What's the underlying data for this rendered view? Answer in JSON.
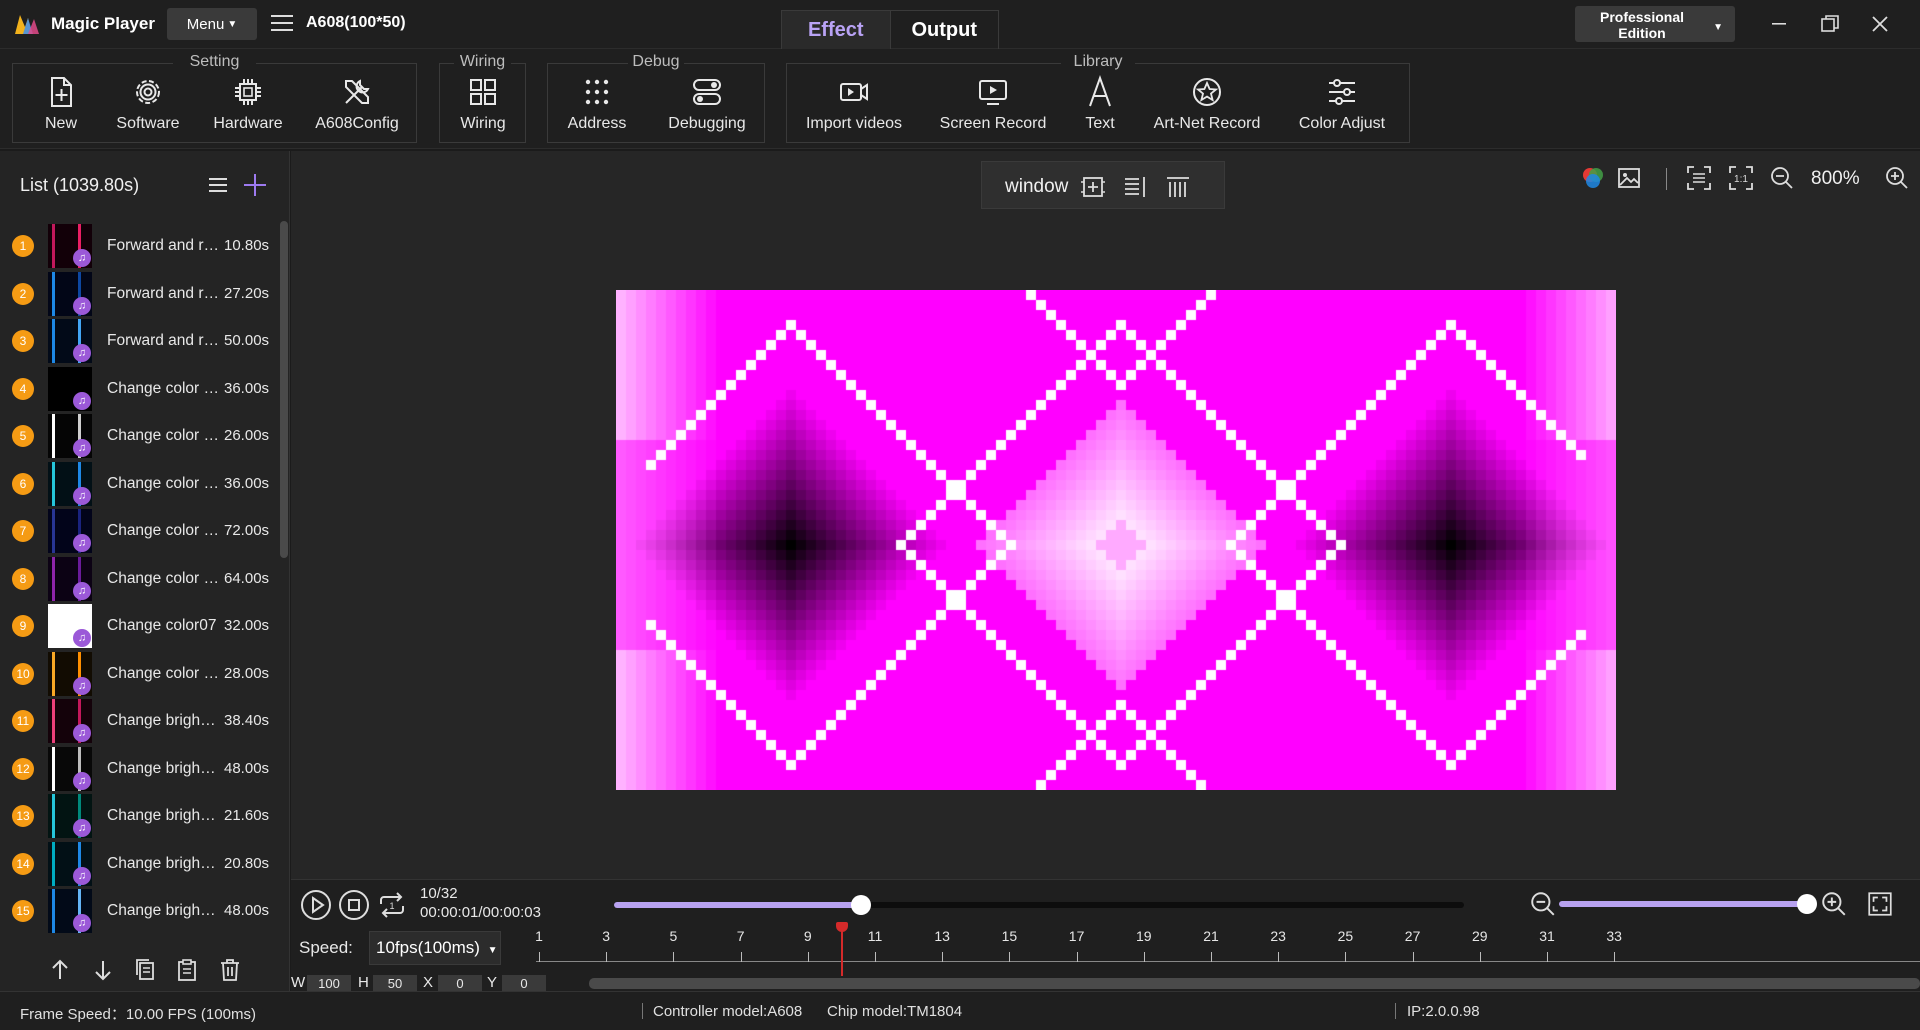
{
  "app": {
    "name": "Magic Player",
    "menu_label": "Menu",
    "device": "A608(100*50)",
    "mode_tabs": [
      "Effect",
      "Output"
    ],
    "active_tab": "Effect",
    "edition_line1": "Professional",
    "edition_line2": "Edition"
  },
  "ribbon": {
    "groups": {
      "setting": "Setting",
      "wiring": "Wiring",
      "debug": "Debug",
      "library": "Library"
    },
    "tools": {
      "new": "New",
      "software": "Software",
      "hardware": "Hardware",
      "a608config": "A608Config",
      "wiring": "Wiring",
      "address": "Address",
      "debugging": "Debugging",
      "import_videos": "Import videos",
      "screen_record": "Screen Record",
      "text": "Text",
      "artnet_record": "Art-Net Record",
      "color_adjust": "Color Adjust"
    }
  },
  "list": {
    "header": "List  (1039.80s)",
    "items": [
      {
        "num": "1",
        "name": "Forward and r…",
        "duration": "10.80s",
        "thumb": "#c2185b",
        "bars": [
          "#c2185b",
          "#e91e63"
        ],
        "bg": "#120008"
      },
      {
        "num": "2",
        "name": "Forward and r…",
        "duration": "27.20s",
        "thumb": "#1565c0",
        "bars": [
          "#1e88e5",
          "#0d47a1"
        ],
        "bg": "#020617"
      },
      {
        "num": "3",
        "name": "Forward and r…",
        "duration": "50.00s",
        "thumb": "#1e88e5",
        "bars": [
          "#1e88e5",
          "#42a5f5"
        ],
        "bg": "#020a18"
      },
      {
        "num": "4",
        "name": "Change color …",
        "duration": "36.00s",
        "thumb": "#000000",
        "bars": [],
        "bg": "#000000"
      },
      {
        "num": "5",
        "name": "Change color …",
        "duration": "26.00s",
        "thumb": "#ffffff",
        "bars": [
          "#ffffff",
          "#cfcfcf"
        ],
        "bg": "#050505"
      },
      {
        "num": "6",
        "name": "Change color …",
        "duration": "36.00s",
        "thumb": "#26c6da",
        "bars": [
          "#26c6da",
          "#1e88e5"
        ],
        "bg": "#021016"
      },
      {
        "num": "7",
        "name": "Change color …",
        "duration": "72.00s",
        "thumb": "#1a237e",
        "bars": [
          "#283593",
          "#1a237e"
        ],
        "bg": "#02041a"
      },
      {
        "num": "8",
        "name": "Change color …",
        "duration": "64.00s",
        "thumb": "#7b1fa2",
        "bars": [
          "#8e24aa",
          "#6a1b9a"
        ],
        "bg": "#0c0214"
      },
      {
        "num": "9",
        "name": "Change color07",
        "duration": "32.00s",
        "thumb": "#ffffff",
        "bars": [],
        "bg": "#ffffff"
      },
      {
        "num": "10",
        "name": "Change color …",
        "duration": "28.00s",
        "thumb": "#f9a825",
        "bars": [
          "#f9a825",
          "#ff8f00"
        ],
        "bg": "#120c02"
      },
      {
        "num": "11",
        "name": "Change brigh…",
        "duration": "38.40s",
        "thumb": "#d81b60",
        "bars": [
          "#ec407a",
          "#c2185b"
        ],
        "bg": "#14020a"
      },
      {
        "num": "12",
        "name": "Change brigh…",
        "duration": "48.00s",
        "thumb": "#eeeeee",
        "bars": [
          "#ffffff",
          "#bdbdbd"
        ],
        "bg": "#080808"
      },
      {
        "num": "13",
        "name": "Change brigh…",
        "duration": "21.60s",
        "thumb": "#26a69a",
        "bars": [
          "#26c6da",
          "#00897b"
        ],
        "bg": "#021412"
      },
      {
        "num": "14",
        "name": "Change brigh…",
        "duration": "20.80s",
        "thumb": "#0097a7",
        "bars": [
          "#00acc1",
          "#1e88e5"
        ],
        "bg": "#021016"
      },
      {
        "num": "15",
        "name": "Change brigh…",
        "duration": "48.00s",
        "thumb": "#1e88e5",
        "bars": [
          "#1e88e5",
          "#64b5f6"
        ],
        "bg": "#020a18"
      }
    ]
  },
  "preview": {
    "window_label": "window",
    "zoom": "800%",
    "effect_color": "#ff00ff",
    "grid_size": "100*50"
  },
  "transport": {
    "frame": "10/32",
    "time": "00:00:01/00:00:03",
    "progress": 0.29,
    "zoom_level": 1.0,
    "speed_label": "Speed:",
    "speed_value": "10fps(100ms)",
    "ruler_ticks": [
      "1",
      "3",
      "5",
      "7",
      "9",
      "11",
      "13",
      "15",
      "17",
      "19",
      "21",
      "23",
      "25",
      "27",
      "29",
      "31",
      "33"
    ],
    "playhead_frame": 10,
    "w_label": "W",
    "w_value": "100",
    "h_label": "H",
    "h_value": "50",
    "x_label": "X",
    "x_value": "0",
    "y_label": "Y",
    "y_value": "0"
  },
  "status": {
    "frame_speed": "Frame Speed：10.00 FPS (100ms)",
    "controller": "Controller model:A608",
    "chip": "Chip model:TM1804",
    "ip": "IP:2.0.0.98"
  },
  "colors": {
    "accent": "#b9a3f5",
    "badge": "#f59b14",
    "playhead": "#d42a2a"
  }
}
